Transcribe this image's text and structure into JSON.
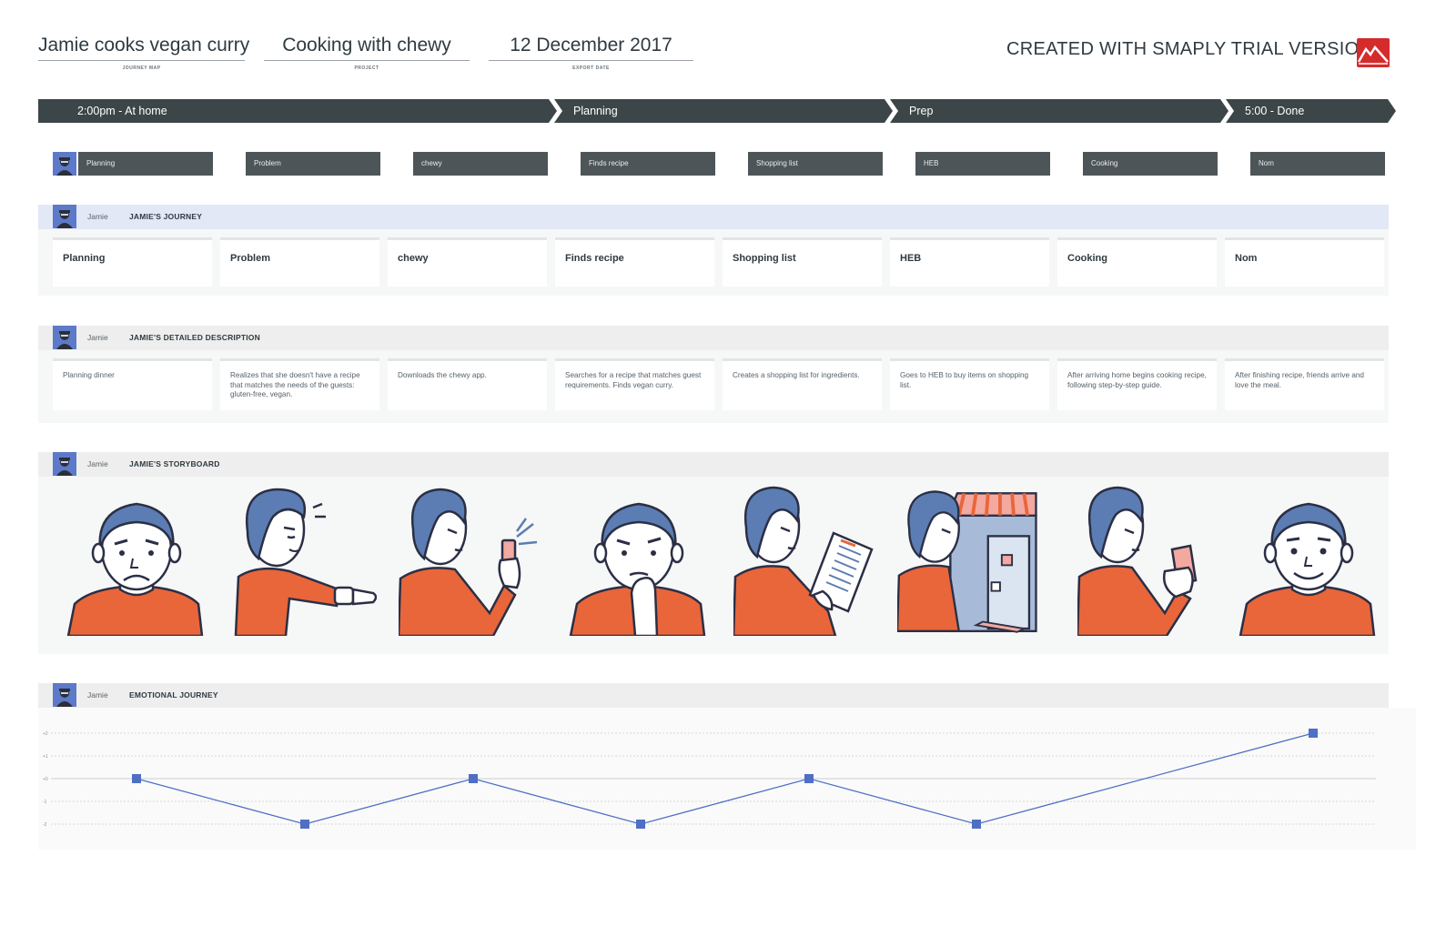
{
  "header": {
    "journey_map": {
      "value": "Jamie cooks vegan curry",
      "caption": "JOURNEY MAP"
    },
    "project": {
      "value": "Cooking with chewy",
      "caption": "PROJECT"
    },
    "export_date": {
      "value": "12 December 2017",
      "caption": "EXPORT DATE"
    },
    "trial_notice": "CREATED WITH SMAPLY TRIAL VERSION",
    "logo_icon": "smaply-mountain-logo"
  },
  "phases": [
    "2:00pm - At home",
    "Planning",
    "Prep",
    "5:00 - Done"
  ],
  "steps": [
    "Planning",
    "Problem",
    "chewy",
    "Finds recipe",
    "Shopping list",
    "HEB",
    "Cooking",
    "Nom"
  ],
  "persona": {
    "name": "Jamie",
    "avatar_icon": "persona-avatar-icon"
  },
  "lanes": {
    "journey": {
      "title": "JAMIE'S JOURNEY",
      "cards": [
        "Planning",
        "Problem",
        "chewy",
        "Finds recipe",
        "Shopping list",
        "HEB",
        "Cooking",
        "Nom"
      ]
    },
    "description": {
      "title": "JAMIE'S DETAILED DESCRIPTION",
      "cards": [
        "Planning dinner",
        "Realizes that she doesn't have a recipe that matches the needs of the guests: gluten-free, vegan.",
        "Downloads the chewy app.",
        "Searches for a recipe that matches guest requirements. Finds vegan curry.",
        "Creates a shopping list for ingredients.",
        "Goes to HEB to buy items on shopping list.",
        "After arriving home begins cooking recipe, following step-by-step guide.",
        "After finishing recipe, friends arrive and love the meal."
      ]
    },
    "storyboard": {
      "title": "JAMIE'S STORYBOARD",
      "frames": [
        "sad-face-illustration",
        "checking-watch-illustration",
        "phone-app-illustration",
        "thinking-face-illustration",
        "reading-recipe-illustration",
        "store-front-illustration",
        "phone-cooking-illustration",
        "happy-face-illustration"
      ]
    },
    "emotion": {
      "title": "EMOTIONAL JOURNEY"
    }
  },
  "colors": {
    "phase_bg": "#3c4649",
    "step_bg": "#4d5558",
    "journey_header_bg": "#e3e8f7",
    "lane_header_bg": "#eeeeee",
    "accent_blue": "#4f6fc4",
    "accent_orange": "#e8663a",
    "logo_red": "#d52b2b"
  },
  "chart_data": {
    "type": "line",
    "x": [
      "Planning",
      "Problem",
      "chewy",
      "Finds recipe",
      "Shopping list",
      "HEB",
      "Nom"
    ],
    "series": [
      {
        "values": [
          0,
          -2,
          0,
          -2,
          0,
          -2,
          2
        ]
      }
    ],
    "ylim": [
      -2,
      2
    ],
    "yticks": [
      "+2",
      "+1",
      "+0",
      "-1",
      "-2"
    ],
    "grid": true
  }
}
